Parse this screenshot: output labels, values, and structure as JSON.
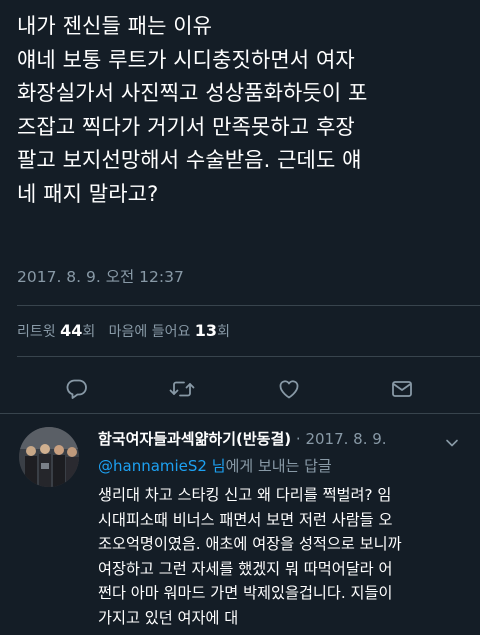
{
  "tweet": {
    "lines": [
      "내가 젠신들 패는 이유",
      "얘네 보통 루트가 시디충짓하면서 여자",
      "화장실가서 사진찍고 성상품화하듯이 포",
      "즈잡고 찍다가 거기서 만족못하고 후장",
      "팔고 보지선망해서 수술받음. 근데도 얘",
      "네 패지 말라고?"
    ],
    "timestamp": "2017. 8. 9. 오전 12:37"
  },
  "stats": {
    "retweet_label": "리트윗",
    "retweet_count": "44",
    "retweet_unit": "회",
    "like_label": "마음에 들어요",
    "like_count": "13",
    "like_unit": "회"
  },
  "actions": {
    "icons": [
      "reply-icon",
      "retweet-icon",
      "like-icon",
      "message-icon"
    ]
  },
  "reply": {
    "author": "함국여자들과섹얆하기(반동결)",
    "date": "· 2017. 8. 9.",
    "mention": "@hannamieS2",
    "mention_suffix": "님",
    "to_text": "에게 보내는 답글",
    "lines": [
      "생리대 차고 스타킹 신고 왜 다리를 쩍벌려? 임",
      "시대피소때 비너스 패면서 보면 저런 사람들 오",
      "조오억명이였음. 애초에 여장을 성적으로 보니까",
      "여장하고 그런 자세를 했겠지 뭐 따먹어달라 어",
      "쩐다 아마 워마드 가면 박제있을겁니다. 지들이",
      "가지고 있던 여자에 대"
    ]
  },
  "colors": {
    "background": "#141d26",
    "text": "#ffffff",
    "muted": "#8899a6",
    "link": "#1da1f2",
    "divider": "#38444d"
  }
}
